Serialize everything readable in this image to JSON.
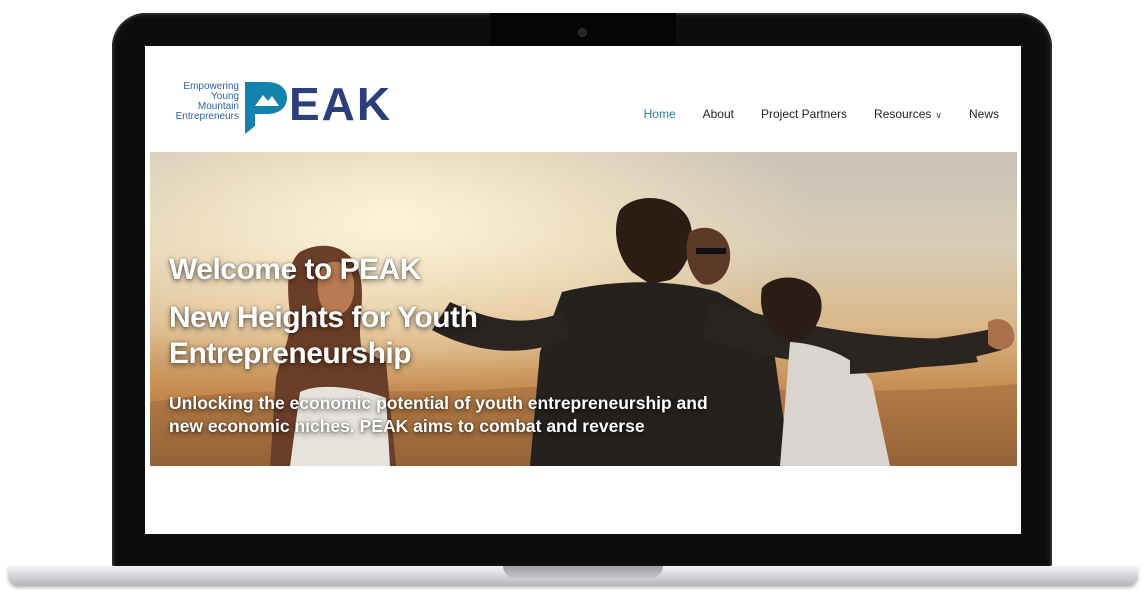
{
  "site": {
    "logo": {
      "tagline_lines": [
        "Empowering",
        "Young",
        "Mountain",
        "Entrepreneurs"
      ],
      "wordmark": "PEAK",
      "colors": {
        "teal": "#0f8fae",
        "navy": "#2d3f7a",
        "purple": "#4a3b8f"
      }
    },
    "nav": {
      "items": [
        {
          "label": "Home",
          "active": true
        },
        {
          "label": "About"
        },
        {
          "label": "Project Partners"
        },
        {
          "label": "Resources",
          "has_dropdown": true,
          "icon": "chevron-down-icon"
        },
        {
          "label": "News"
        }
      ],
      "active_color": "#2b7aa6"
    },
    "hero": {
      "title": "Welcome to PEAK",
      "subtitle": "New Heights for Youth Entrepreneurship",
      "body": "Unlocking the economic potential of youth entrepreneurship and new economic niches. PEAK aims to combat and reverse"
    }
  }
}
